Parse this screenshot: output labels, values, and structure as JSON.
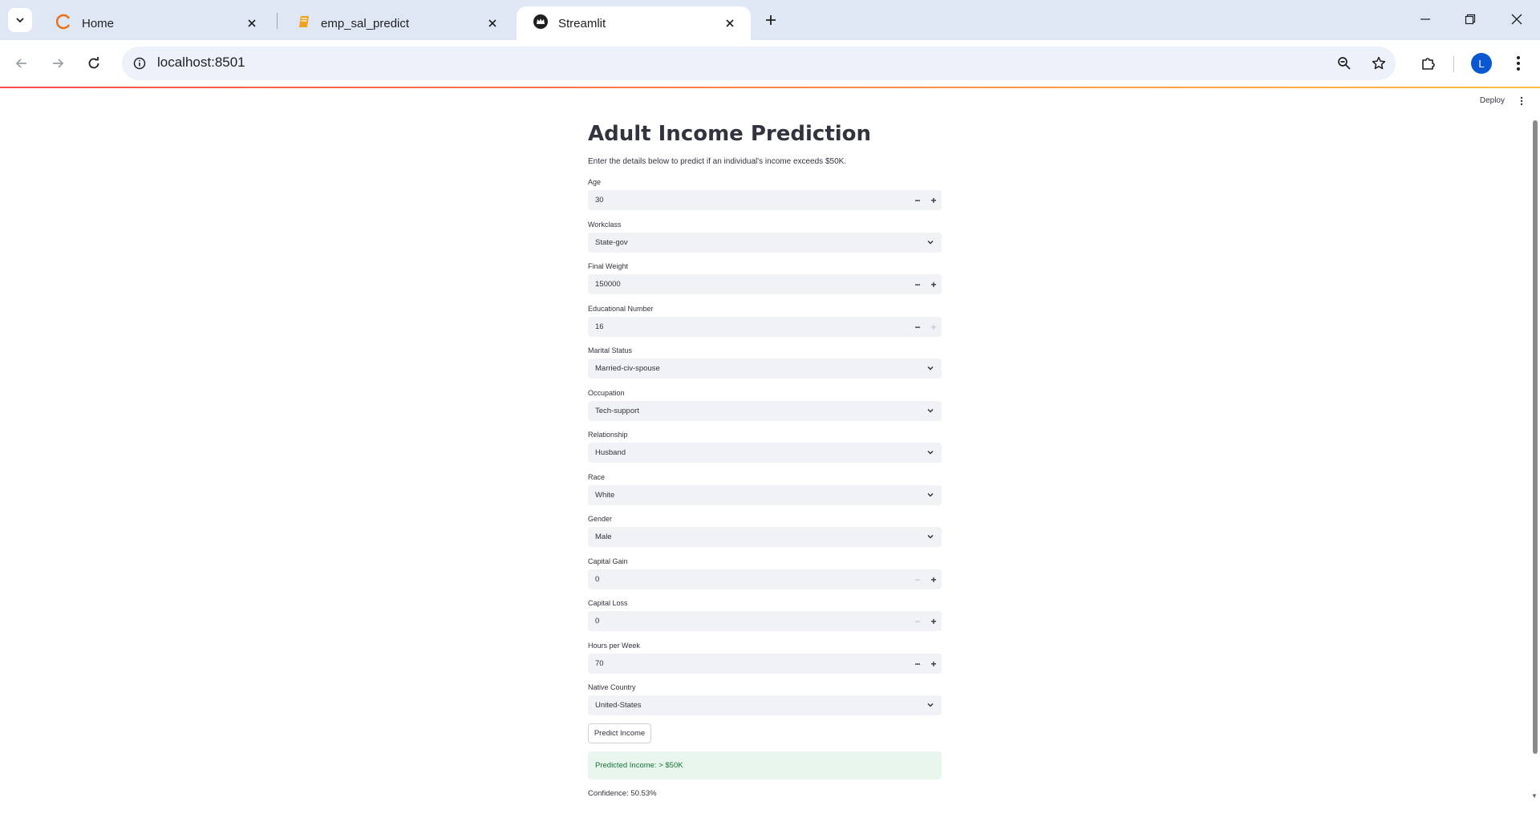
{
  "browser": {
    "tabs": [
      {
        "title": "Home",
        "icon": "loader-icon",
        "active": false
      },
      {
        "title": "emp_sal_predict",
        "icon": "notebook-icon",
        "active": false
      },
      {
        "title": "Streamlit",
        "icon": "streamlit-crown-icon",
        "active": true
      }
    ],
    "url": "localhost:8501",
    "profile_initial": "L",
    "colors": {
      "tabstrip": "#dfe7f5",
      "omnibox": "#edf2fa",
      "profile": "#0b57d0"
    }
  },
  "app": {
    "deploy_label": "Deploy",
    "title": "Adult Income Prediction",
    "subtitle": "Enter the details below to predict if an individual's income exceeds $50K.",
    "fields": {
      "age": {
        "label": "Age",
        "value": "30",
        "type": "number"
      },
      "workclass": {
        "label": "Workclass",
        "value": "State-gov",
        "type": "select"
      },
      "final_weight": {
        "label": "Final Weight",
        "value": "150000",
        "type": "number"
      },
      "educational_number": {
        "label": "Educational Number",
        "value": "16",
        "type": "number",
        "plus_disabled": true
      },
      "marital_status": {
        "label": "Marital Status",
        "value": "Married-civ-spouse",
        "type": "select"
      },
      "occupation": {
        "label": "Occupation",
        "value": "Tech-support",
        "type": "select"
      },
      "relationship": {
        "label": "Relationship",
        "value": "Husband",
        "type": "select"
      },
      "race": {
        "label": "Race",
        "value": "White",
        "type": "select"
      },
      "gender": {
        "label": "Gender",
        "value": "Male",
        "type": "select"
      },
      "capital_gain": {
        "label": "Capital Gain",
        "value": "0",
        "type": "number",
        "minus_disabled": true
      },
      "capital_loss": {
        "label": "Capital Loss",
        "value": "0",
        "type": "number",
        "minus_disabled": true
      },
      "hours_per_week": {
        "label": "Hours per Week",
        "value": "70",
        "type": "number"
      },
      "native_country": {
        "label": "Native Country",
        "value": "United-States",
        "type": "select"
      }
    },
    "predict_button": "Predict Income",
    "result": "Predicted Income: > $50K",
    "confidence": "Confidence: 50.53%",
    "colors": {
      "text": "#31333f",
      "input_bg": "#f0f2f6",
      "success_bg": "#e8f6ee",
      "success_text": "#177233"
    }
  }
}
